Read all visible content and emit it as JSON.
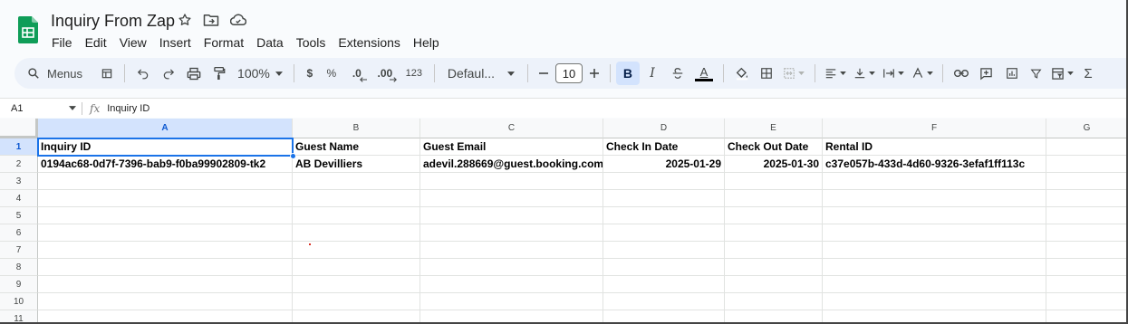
{
  "app": {
    "title": "Inquiry From Zap"
  },
  "menubar": [
    "File",
    "Edit",
    "View",
    "Insert",
    "Format",
    "Data",
    "Tools",
    "Extensions",
    "Help"
  ],
  "toolbar": {
    "search_label": "Menus",
    "zoom": "100%",
    "currency": "$",
    "percent": "%",
    "decrease_decimal": ".0",
    "increase_decimal": ".00",
    "number_format": "123",
    "font": "Defaul...",
    "font_size": "10",
    "bold": "B",
    "italic": "I",
    "text_color": "A",
    "sum": "Σ"
  },
  "formula_bar": {
    "cell_ref": "A1",
    "fx": "fx",
    "content": "Inquiry ID"
  },
  "columns": [
    "A",
    "B",
    "C",
    "D",
    "E",
    "F",
    "G"
  ],
  "rows": [
    "1",
    "2",
    "3",
    "4",
    "5",
    "6",
    "7",
    "8",
    "9",
    "10",
    "11"
  ],
  "cells": {
    "header": [
      "Inquiry ID",
      "Guest Name",
      "Guest Email",
      "Check In Date",
      "Check Out Date",
      "Rental ID"
    ],
    "row2": [
      "0194ac68-0d7f-7396-bab9-f0ba99902809-tk2",
      "AB Devilliers",
      "adevil.288669@guest.booking.com",
      "2025-01-29",
      "2025-01-30",
      "c37e057b-433d-4d60-9326-3efaf1ff113c"
    ]
  },
  "colors": {
    "accent": "#1a73e8",
    "logo_green": "#0f9d58",
    "toolbar_bg": "#edf2fa"
  },
  "selected_cell": "A1"
}
